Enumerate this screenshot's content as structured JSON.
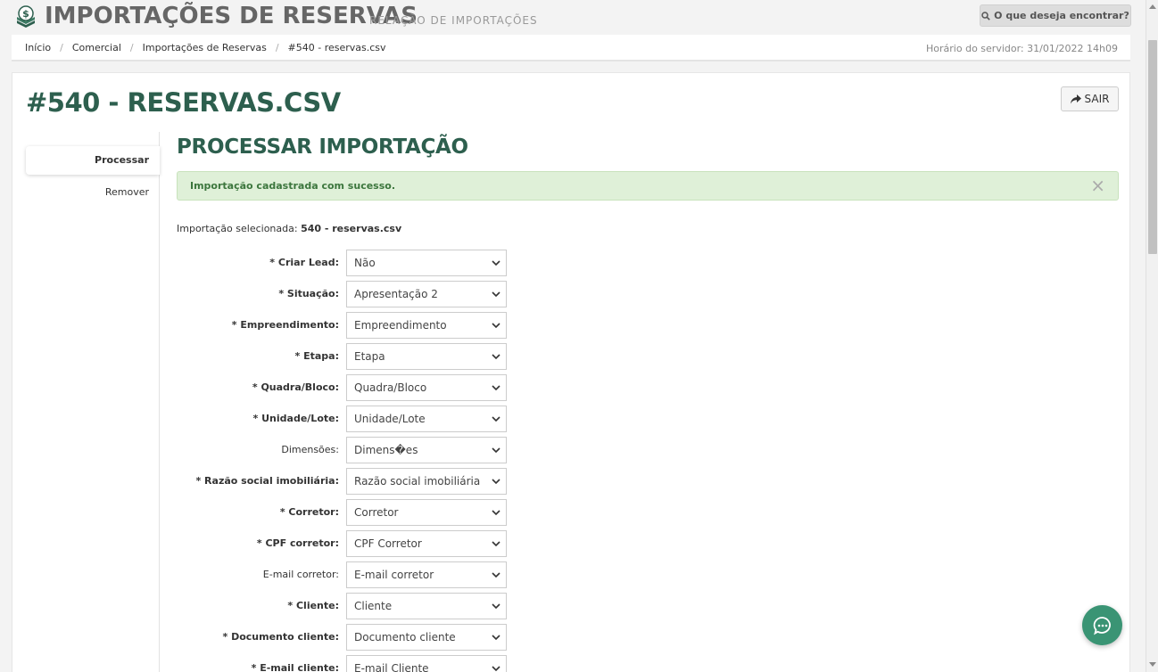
{
  "header": {
    "title": "IMPORTAÇÕES DE RESERVAS",
    "subtitle": "RELAÇÃO DE IMPORTAÇÕES",
    "search_label": "O que deseja encontrar?"
  },
  "breadcrumb": {
    "items": [
      "Início",
      "Comercial",
      "Importações de Reservas",
      "#540 - reservas.csv"
    ],
    "server_time": "Horário do servidor: 31/01/2022 14h09"
  },
  "page": {
    "title": "#540 - RESERVAS.CSV",
    "exit_label": "SAIR"
  },
  "side_nav": {
    "items": [
      {
        "label": "Processar",
        "active": true
      },
      {
        "label": "Remover",
        "active": false
      }
    ]
  },
  "section": {
    "title": "PROCESSAR IMPORTAÇÃO",
    "alert": "Importação cadastrada com sucesso.",
    "alert_close": "×",
    "selected_label": "Importação selecionada:",
    "selected_value": "540 - reservas.csv"
  },
  "form": {
    "fields": [
      {
        "label": "* Criar Lead:",
        "required": true,
        "value": "Não"
      },
      {
        "label": "* Situação:",
        "required": true,
        "value": "Apresentação 2"
      },
      {
        "label": "* Empreendimento:",
        "required": true,
        "value": "Empreendimento"
      },
      {
        "label": "* Etapa:",
        "required": true,
        "value": "Etapa"
      },
      {
        "label": "* Quadra/Bloco:",
        "required": true,
        "value": "Quadra/Bloco"
      },
      {
        "label": "* Unidade/Lote:",
        "required": true,
        "value": "Unidade/Lote"
      },
      {
        "label": "Dimensões:",
        "required": false,
        "value": "Dimens�es"
      },
      {
        "label": "* Razão social imobiliária:",
        "required": true,
        "value": "Razão social imobiliária"
      },
      {
        "label": "* Corretor:",
        "required": true,
        "value": "Corretor"
      },
      {
        "label": "* CPF corretor:",
        "required": true,
        "value": "CPF Corretor"
      },
      {
        "label": "E-mail corretor:",
        "required": false,
        "value": "E-mail corretor"
      },
      {
        "label": "* Cliente:",
        "required": true,
        "value": "Cliente"
      },
      {
        "label": "* Documento cliente:",
        "required": true,
        "value": "Documento cliente"
      },
      {
        "label": "* E-mail cliente:",
        "required": true,
        "value": "E-mail Cliente"
      }
    ]
  },
  "colors": {
    "brand_green": "#2d5f4e",
    "success_bg": "#dff0d8",
    "success_text": "#3c763d",
    "fab": "#3a9474"
  },
  "icons": [
    "dollar-stack-icon",
    "search-icon",
    "share-arrow-icon",
    "close-icon",
    "chevron-down-icon",
    "chat-icon"
  ]
}
